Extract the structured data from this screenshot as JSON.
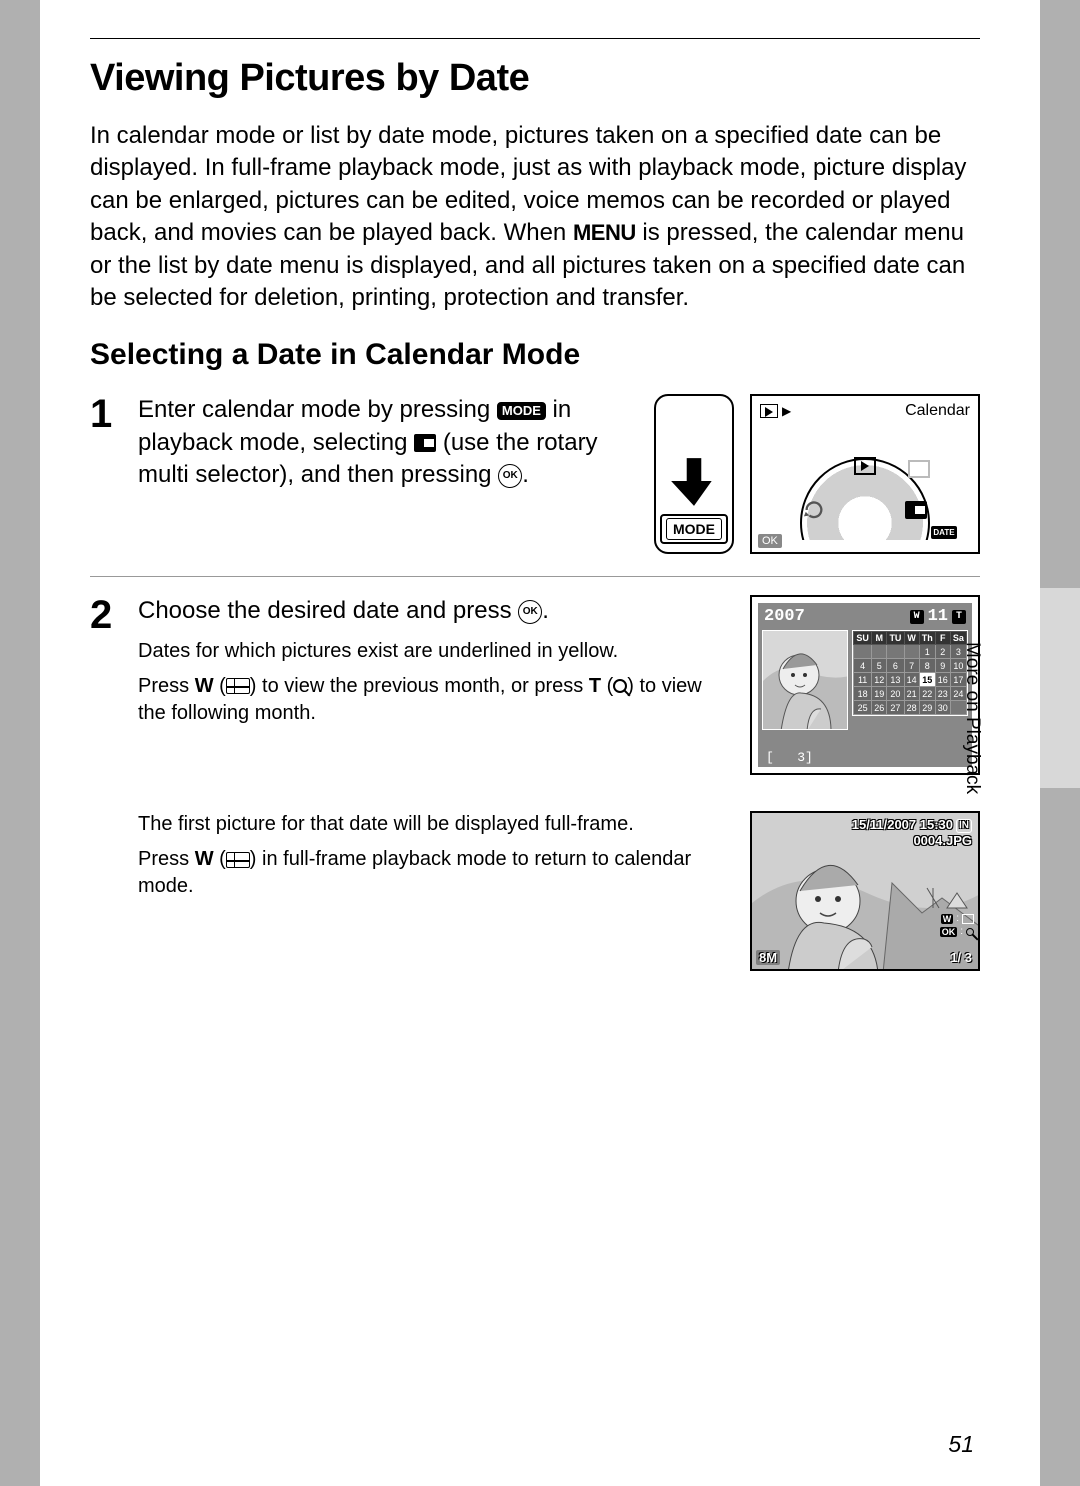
{
  "title": "Viewing Pictures by Date",
  "intro_pre": "In calendar mode or list by date mode, pictures taken on a specified date can be displayed. In full-frame playback mode, just as with playback mode, picture display can be enlarged, pictures can be edited, voice memos can be recorded or played back, and movies can be played back. When ",
  "intro_menu": "MENU",
  "intro_post": " is pressed, the calendar menu or the list by date menu is displayed, and all pictures taken on a specified date can be selected for deletion, printing, protection and transfer.",
  "subtitle": "Selecting a Date in Calendar Mode",
  "step1": {
    "num": "1",
    "a": "Enter calendar mode by pressing ",
    "mode": "MODE",
    "b": " in playback mode, selecting ",
    "c": " (use the rotary multi selector), and then pressing ",
    "d": "."
  },
  "wheel_label": "Calendar",
  "step2": {
    "num": "2",
    "main_a": "Choose the desired date and press ",
    "main_b": ".",
    "sub1": "Dates for which pictures exist are underlined in yellow.",
    "sub2_a": "Press ",
    "sub2_w": "W",
    "sub2_b": " (",
    "sub2_c": ") to view the previous month, or press ",
    "sub2_t": "T",
    "sub2_d": " (",
    "sub2_e": ") to view the following month.",
    "sub3": "The first picture for that date will be displayed full-frame.",
    "sub4_a": "Press ",
    "sub4_w": "W",
    "sub4_b": " (",
    "sub4_c": ") in full-frame playback mode to return to calendar mode."
  },
  "calendar": {
    "year": "2007",
    "month": "11",
    "days": [
      "SU",
      "M",
      "TU",
      "W",
      "Th",
      "F",
      "Sa"
    ],
    "weeks": [
      [
        "",
        "",
        "",
        "",
        "1",
        "2",
        "3"
      ],
      [
        "4",
        "5",
        "6",
        "7",
        "8",
        "9",
        "10"
      ],
      [
        "11",
        "12",
        "13",
        "14",
        "15",
        "16",
        "17"
      ],
      [
        "18",
        "19",
        "20",
        "21",
        "22",
        "23",
        "24"
      ],
      [
        "25",
        "26",
        "27",
        "28",
        "29",
        "30",
        ""
      ]
    ],
    "selected": "15",
    "count": "3"
  },
  "fullframe": {
    "date": "15/11/2007 15:30",
    "file": "0004.JPG",
    "in": "IN",
    "size": "8M",
    "counter": "1/    3",
    "side_w": "W",
    "side_ok": "OK"
  },
  "side_label": "More on Playback",
  "ok_text": "OK",
  "mode_text": "MODE",
  "date_text": "DATE",
  "w_text": "W",
  "t_text": "T",
  "page_num": "51"
}
